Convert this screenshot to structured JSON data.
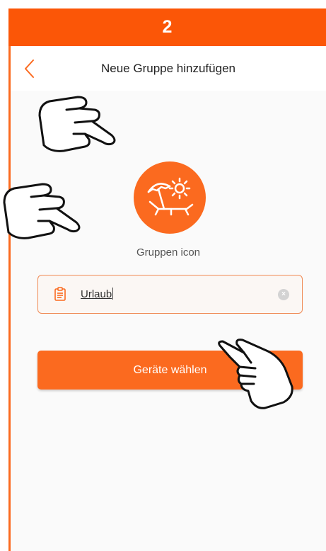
{
  "step": {
    "number": "2"
  },
  "header": {
    "title": "Neue Gruppe hinzufügen",
    "back_icon": "chevron-left-icon"
  },
  "group_icon": {
    "icon": "beach-chair-umbrella-sun-icon",
    "label": "Gruppen icon"
  },
  "name_field": {
    "value": "Urlaub",
    "leading_icon": "clipboard-icon",
    "clear_icon": "clear-circle-icon"
  },
  "actions": {
    "select_devices_label": "Geräte wählen"
  },
  "colors": {
    "accent": "#fb6a1f",
    "step_bar": "#fb5607",
    "field_border": "#f08a55"
  },
  "annotations": {
    "hand_icon": "pointing-hand-icon"
  }
}
